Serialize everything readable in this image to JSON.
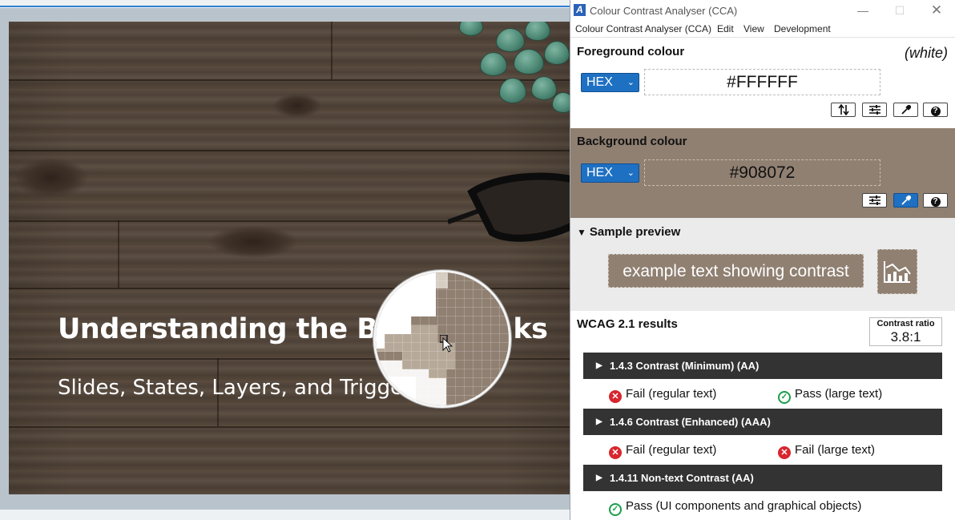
{
  "slide": {
    "title": "Understanding the Bui",
    "title_tail": "ks",
    "subtitle": "Slides, States, Layers, and Triggers"
  },
  "cca": {
    "window_title": "Colour Contrast Analyser (CCA)",
    "logo_letter": "A",
    "menu": [
      "Colour Contrast Analyser (CCA)",
      "Edit",
      "View",
      "Development"
    ],
    "foreground": {
      "title": "Foreground colour",
      "name": "(white)",
      "format": "HEX",
      "value": "#FFFFFF",
      "color": "#FFFFFF"
    },
    "background": {
      "title": "Background colour",
      "format": "HEX",
      "value": "#908072",
      "color": "#908072"
    },
    "preview": {
      "title": "Sample preview",
      "text": "example text showing contrast"
    },
    "wcag": {
      "title": "WCAG 2.1 results",
      "ratio_label": "Contrast ratio",
      "ratio_value": "3.8:1",
      "criteria": [
        {
          "label": "1.4.3 Contrast (Minimum) (AA)",
          "results": [
            {
              "status": "fail",
              "text": "Fail (regular text)"
            },
            {
              "status": "pass",
              "text": "Pass (large text)"
            }
          ]
        },
        {
          "label": "1.4.6 Contrast (Enhanced) (AAA)",
          "results": [
            {
              "status": "fail",
              "text": "Fail (regular text)"
            },
            {
              "status": "fail",
              "text": "Fail (large text)"
            }
          ]
        },
        {
          "label": "1.4.11 Non-text Contrast (AA)",
          "results": [
            {
              "status": "pass",
              "text": "Pass (UI components and graphical objects)"
            }
          ]
        }
      ]
    }
  },
  "colors": {
    "accent": "#1E70C2",
    "pass": "#1A9E4A",
    "fail": "#D8262E",
    "criterion_bar": "#333333"
  }
}
